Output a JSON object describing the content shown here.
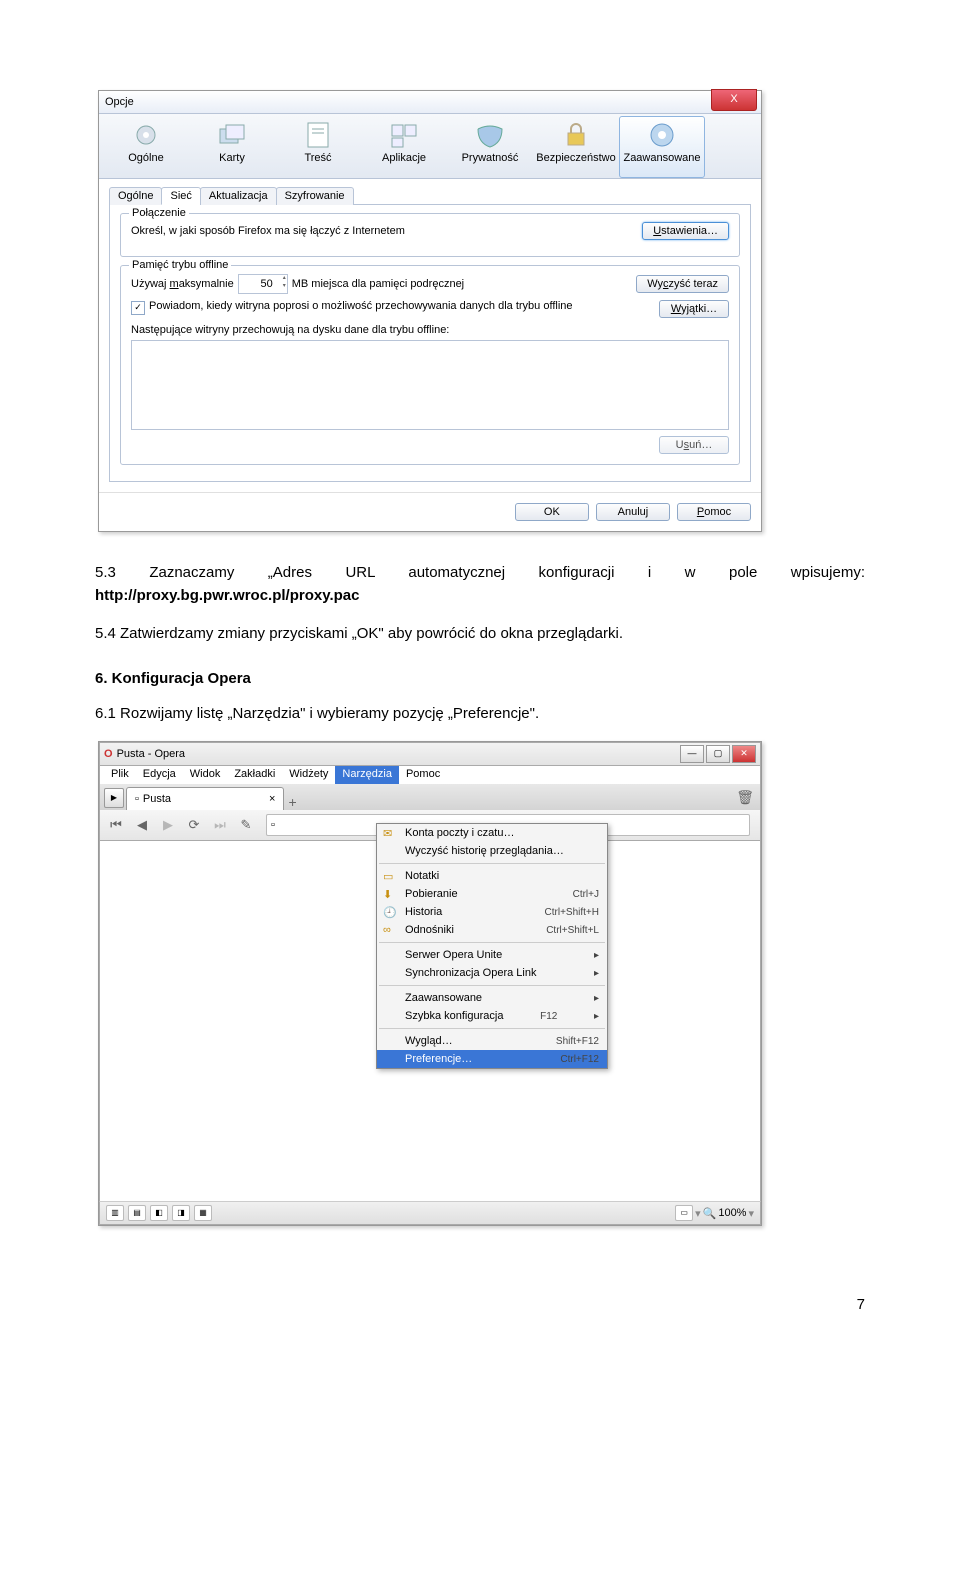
{
  "firefox": {
    "title": "Opcje",
    "close": "X",
    "categories": [
      "Ogólne",
      "Karty",
      "Treść",
      "Aplikacje",
      "Prywatność",
      "Bezpieczeństwo",
      "Zaawansowane"
    ],
    "subtabs": [
      "Ogólne",
      "Sieć",
      "Aktualizacja",
      "Szyfrowanie"
    ],
    "connection": {
      "legend": "Połączenie",
      "text": "Określ, w jaki sposób Firefox ma się łączyć z Internetem",
      "button": "Ustawienia…"
    },
    "offline": {
      "legend": "Pamięć trybu offline",
      "use_label_pre": "Używaj maksymalnie",
      "use_value": "50",
      "use_label_post": "MB miejsca dla pamięci podręcznej",
      "clear": "Wyczyść teraz",
      "notify": "Powiadom, kiedy witryna poprosi o możliwość przechowywania danych dla trybu offline",
      "exceptions": "Wyjątki…",
      "sites_label": "Następujące witryny przechowują na dysku dane dla trybu offline:",
      "remove": "Usuń…"
    },
    "footer": {
      "ok": "OK",
      "cancel": "Anuluj",
      "help": "Pomoc"
    }
  },
  "doc": {
    "p53_pre": "5.3 Zaznaczamy „Adres URL automatycznej konfiguracji i w pole wpisujemy: ",
    "p53_bold": "http://proxy.bg.pwr.wroc.pl/proxy.pac",
    "p54": "5.4 Zatwierdzamy zmiany przyciskami „OK\" aby powrócić do okna przeglądarki.",
    "h6": "6.   Konfiguracja Opera",
    "p61": "6.1 Rozwijamy listę „Narzędzia\" i wybieramy pozycję „Preferencje\"."
  },
  "opera": {
    "title": "Pusta - Opera",
    "menubar": [
      "Plik",
      "Edycja",
      "Widok",
      "Zakładki",
      "Widżety",
      "Narzędzia",
      "Pomoc"
    ],
    "tab": "Pusta",
    "tab_close": "×",
    "addr_icon": "📄",
    "menu": [
      {
        "icon": "✉",
        "label": "Konta poczty i czatu…"
      },
      {
        "icon": "",
        "label": "Wyczyść historię przeglądania…"
      },
      {
        "sep": true
      },
      {
        "icon": "▭",
        "label": "Notatki"
      },
      {
        "icon": "⬇",
        "label": "Pobieranie",
        "sc": "Ctrl+J"
      },
      {
        "icon": "🕘",
        "label": "Historia",
        "sc": "Ctrl+Shift+H"
      },
      {
        "icon": "∞",
        "label": "Odnośniki",
        "sc": "Ctrl+Shift+L"
      },
      {
        "sep": true
      },
      {
        "icon": "",
        "label": "Serwer Opera Unite",
        "sub": true
      },
      {
        "icon": "",
        "label": "Synchronizacja Opera Link",
        "sub": true
      },
      {
        "sep": true
      },
      {
        "icon": "",
        "label": "Zaawansowane",
        "sub": true
      },
      {
        "icon": "",
        "label": "Szybka konfiguracja",
        "sc": "F12",
        "sub": true
      },
      {
        "sep": true
      },
      {
        "icon": "",
        "label": "Wygląd…",
        "sc": "Shift+F12"
      },
      {
        "icon": "",
        "label": "Preferencje…",
        "sc": "Ctrl+F12",
        "hi": true
      }
    ],
    "zoom": "100%"
  },
  "page_number": "7"
}
